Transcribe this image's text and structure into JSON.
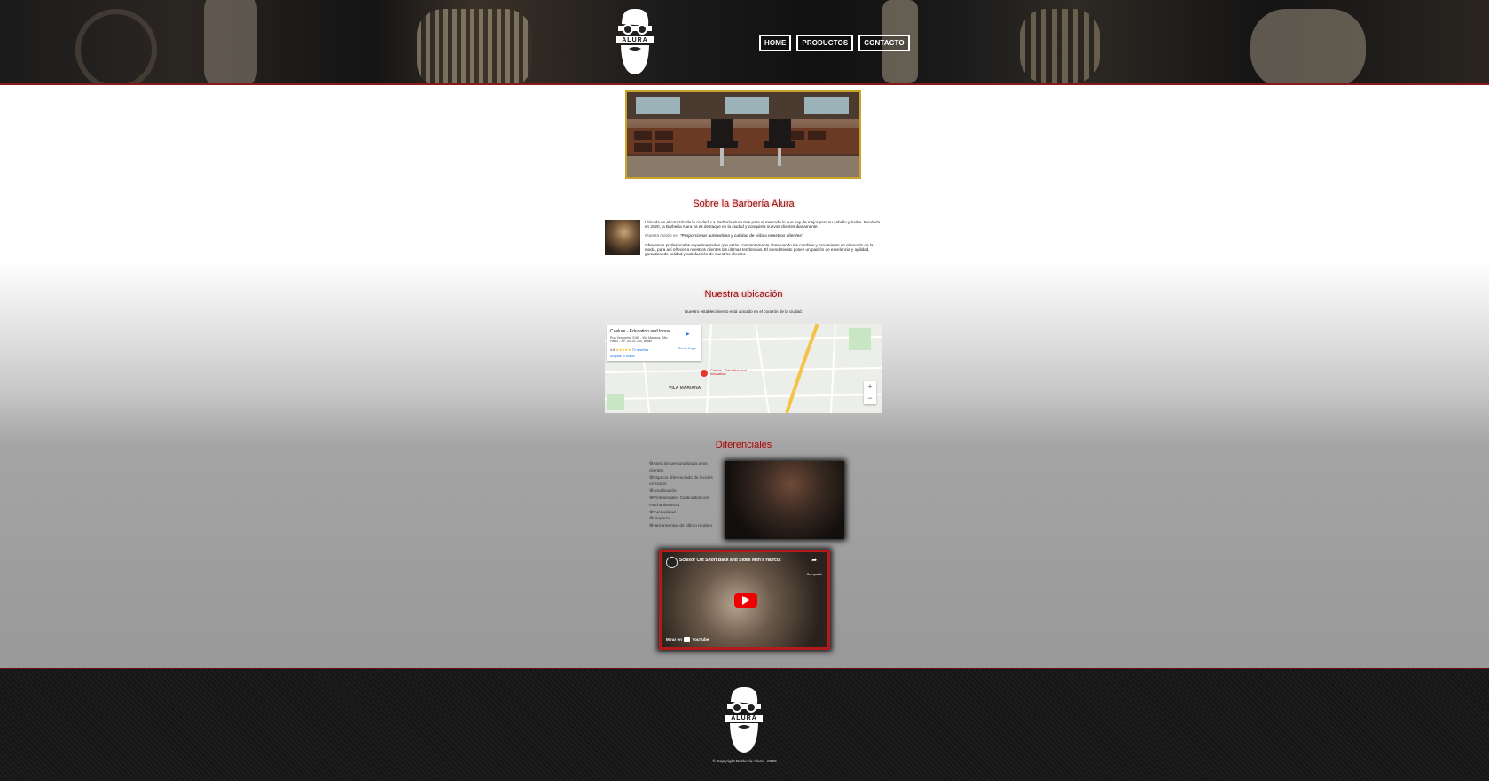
{
  "header": {
    "logo_text": "ALURA",
    "nav": [
      "HOME",
      "PRODUCTOS",
      "CONTACTO"
    ]
  },
  "about": {
    "title": "Sobre la Barbería Alura",
    "p1": "Ubicada en el corazón de la ciudad, La Barbería Alura trae para el mercado lo que hay de mejor para su cabello y barba. Fundada en 2020, la Barbería Alura ya es destaque en la ciudad y conquista nuevos clientes diariamente.",
    "mission_prefix": "Nuestra misión es:",
    "mission": "\"Proporcionar autoestima y calidad de vida a nuestros clientes\"",
    "p2": "Ofrecemos profesionales experimentados que están constantemente observando los cambios y movimiento en el mundo de la moda, para así ofrecer a nuestros clientes las últimas tendencias. El atendimiento posee un padrón de excelencia y agilidad, garantizando calidad y satisfacción de nuestros clientes."
  },
  "location": {
    "title": "Nuestra ubicación",
    "subtitle": "Nuestro establecimiento está ubicado en el corazón de la ciudad.",
    "map": {
      "place_name": "Caelum - Education and Innov...",
      "address": "Rua Vergueiro, 3185 - Vila Mariana, São Paulo - SP, 04101-300, Brasil",
      "rating": "4.6",
      "reviews": "73 reseñas",
      "directions": "Cómo llegar",
      "larger_map": "Ampliar el mapa",
      "pin_label": "Caelum - Education and Innovation",
      "district": "VILA MARIANA",
      "zoom_in": "+",
      "zoom_out": "−"
    }
  },
  "differentials": {
    "title": "Diferenciales",
    "items": [
      "Atención personalizada a los clientes",
      "Espacio diferenciado de locales cercanos",
      "Localización",
      "Profesionales Calificados con mucha destreza",
      "Puntualidad",
      "Limpieza",
      "Herramientas de último modelo"
    ],
    "bullet": "⚙"
  },
  "video": {
    "title": "Scissor Cut Short Back and Sides Men's Haircut",
    "share": "Compartir",
    "watch_on": "Mirar en",
    "platform": "YouTube"
  },
  "footer": {
    "logo_text": "ALURA",
    "copyright": "© Copyright Barbería Alura - 2020"
  },
  "colors": {
    "accent": "#8b0f0f",
    "banner_border": "#c8a52a",
    "video_border": "#b31a1a"
  }
}
